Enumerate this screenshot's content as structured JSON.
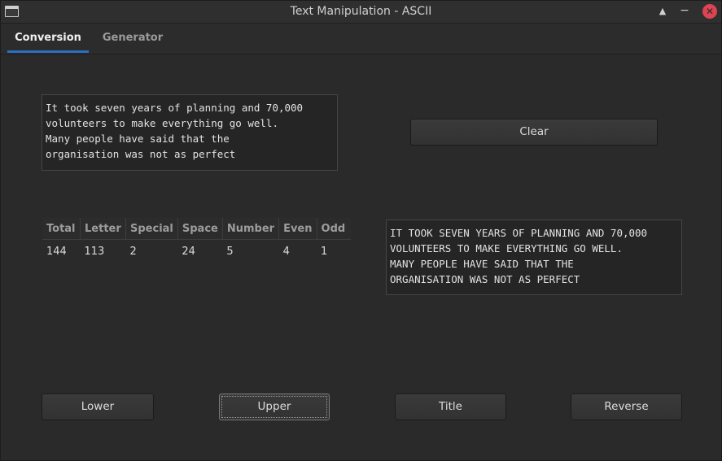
{
  "window": {
    "title": "Text Manipulation - ASCII",
    "controls": {
      "shade": "▲",
      "minimize": "−",
      "close": "✕"
    }
  },
  "tabs": [
    {
      "label": "Conversion",
      "active": true
    },
    {
      "label": "Generator",
      "active": false
    }
  ],
  "input_text": "It took seven years of planning and 70,000\nvolunteers to make everything go well.\nMany people have said that the\norganisation was not as perfect",
  "output_text": "IT TOOK SEVEN YEARS OF PLANNING AND 70,000\nVOLUNTEERS TO MAKE EVERYTHING GO WELL.\nMANY PEOPLE HAVE SAID THAT THE\nORGANISATION WAS NOT AS PERFECT",
  "buttons": {
    "clear": "Clear",
    "lower": "Lower",
    "upper": "Upper",
    "title": "Title",
    "reverse": "Reverse"
  },
  "stats": {
    "headers": [
      "Total",
      "Letter",
      "Special",
      "Space",
      "Number",
      "Even",
      "Odd"
    ],
    "values": [
      "144",
      "113",
      "2",
      "24",
      "5",
      "4",
      "1"
    ]
  },
  "colors": {
    "background": "#2a2a2a",
    "accent": "#2c6fbf",
    "close": "#da4453"
  },
  "icons": {
    "app": "window-icon",
    "shade": "shade-icon",
    "minimize": "minimize-icon",
    "close": "close-icon"
  }
}
